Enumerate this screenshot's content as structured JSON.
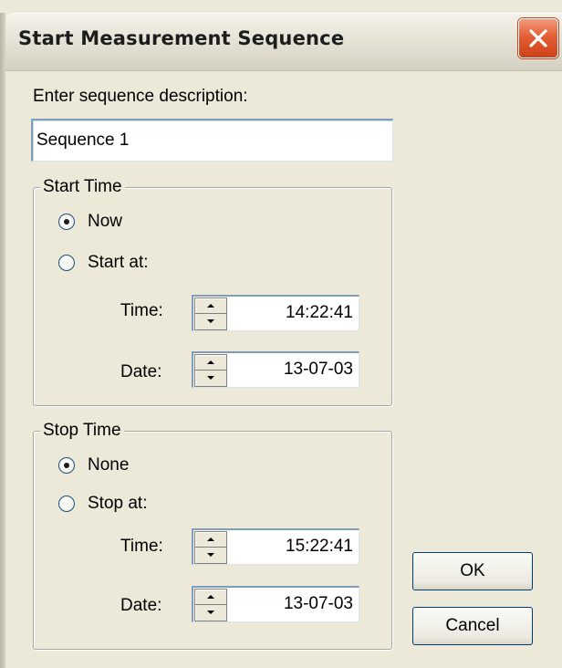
{
  "dialog": {
    "title": "Start Measurement Sequence",
    "description_label": "Enter sequence description:",
    "description_value": "Sequence 1"
  },
  "start_time": {
    "legend": "Start Time",
    "option_now": "Now",
    "option_start_at": "Start at:",
    "selected": "Now",
    "time_label": "Time:",
    "time_value": "14:22:41",
    "date_label": "Date:",
    "date_value": "13-07-03"
  },
  "stop_time": {
    "legend": "Stop Time",
    "option_none": "None",
    "option_stop_at": "Stop at:",
    "selected": "None",
    "time_label": "Time:",
    "time_value": "15:22:41",
    "date_label": "Date:",
    "date_value": "13-07-03"
  },
  "buttons": {
    "ok": "OK",
    "cancel": "Cancel"
  },
  "icons": {
    "close": "close-icon",
    "spin_up": "spin-up-icon",
    "spin_down": "spin-down-icon"
  },
  "colors": {
    "close_button": "#e45e36",
    "field_border": "#7f9db9",
    "dialog_background": "#ece9d8"
  }
}
